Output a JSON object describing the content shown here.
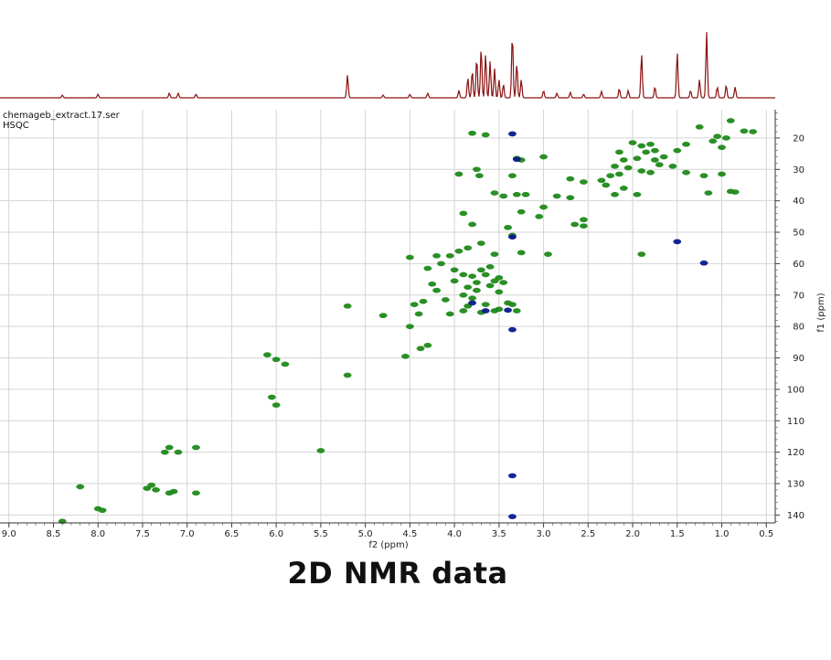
{
  "file_name": "chemageb_extract.17.ser",
  "experiment": "HSQC",
  "caption": "2D NMR data",
  "colors": {
    "positive": "#1f8a1a",
    "negative": "#0a1a8c",
    "trace": "#8b1010",
    "grid": "#d4d4d4"
  },
  "chart_data": {
    "type": "scatter",
    "xlabel": "f2 (ppm)",
    "ylabel": "f1 (ppm)",
    "xlim": [
      9.1,
      0.4
    ],
    "ylim": [
      11,
      142.5
    ],
    "x_ticks": [
      "9.0",
      "8.5",
      "8.0",
      "7.5",
      "7.0",
      "6.5",
      "6.0",
      "5.5",
      "5.0",
      "4.5",
      "4.0",
      "3.5",
      "3.0",
      "2.5",
      "2.0",
      "1.5",
      "1.0",
      "0.5"
    ],
    "y_ticks": [
      "20",
      "30",
      "40",
      "50",
      "60",
      "70",
      "80",
      "90",
      "100",
      "110",
      "120",
      "130",
      "140"
    ],
    "grid": true,
    "series": [
      {
        "sign": "positive",
        "points": [
          [
            3.8,
            18.5
          ],
          [
            3.65,
            19.0
          ],
          [
            1.05,
            19.5
          ],
          [
            0.95,
            20.0
          ],
          [
            0.9,
            14.5
          ],
          [
            0.75,
            17.8
          ],
          [
            0.65,
            18.0
          ],
          [
            1.25,
            16.5
          ],
          [
            1.1,
            21.0
          ],
          [
            1.0,
            23.0
          ],
          [
            2.0,
            21.5
          ],
          [
            1.9,
            22.5
          ],
          [
            1.85,
            24.5
          ],
          [
            1.75,
            24.0
          ],
          [
            1.65,
            26.0
          ],
          [
            1.5,
            24.0
          ],
          [
            1.4,
            22.0
          ],
          [
            1.75,
            27.0
          ],
          [
            1.7,
            28.5
          ],
          [
            1.55,
            29.0
          ],
          [
            1.95,
            26.5
          ],
          [
            2.1,
            27.0
          ],
          [
            2.2,
            29.0
          ],
          [
            2.05,
            29.5
          ],
          [
            1.9,
            30.5
          ],
          [
            1.8,
            31.0
          ],
          [
            2.15,
            31.5
          ],
          [
            2.25,
            32.0
          ],
          [
            2.35,
            33.5
          ],
          [
            2.55,
            34.0
          ],
          [
            2.7,
            33.0
          ],
          [
            2.3,
            35.0
          ],
          [
            2.1,
            36.0
          ],
          [
            1.95,
            38.0
          ],
          [
            2.2,
            38.0
          ],
          [
            1.4,
            31.0
          ],
          [
            1.2,
            32.0
          ],
          [
            1.0,
            31.5
          ],
          [
            0.9,
            37.0
          ],
          [
            0.85,
            37.2
          ],
          [
            1.15,
            37.5
          ],
          [
            2.15,
            24.5
          ],
          [
            1.8,
            22.0
          ],
          [
            3.3,
            26.5
          ],
          [
            3.25,
            27.0
          ],
          [
            3.0,
            26.0
          ],
          [
            3.35,
            32.0
          ],
          [
            3.75,
            30.0
          ],
          [
            3.72,
            32.0
          ],
          [
            3.3,
            38.0
          ],
          [
            3.2,
            38.0
          ],
          [
            2.85,
            38.5
          ],
          [
            2.7,
            39.0
          ],
          [
            3.45,
            38.5
          ],
          [
            3.55,
            37.5
          ],
          [
            3.95,
            31.5
          ],
          [
            3.0,
            42.0
          ],
          [
            3.25,
            43.5
          ],
          [
            3.05,
            45.0
          ],
          [
            2.55,
            46.0
          ],
          [
            2.65,
            47.5
          ],
          [
            2.55,
            48.0
          ],
          [
            3.4,
            48.5
          ],
          [
            3.35,
            51.0
          ],
          [
            3.9,
            44.0
          ],
          [
            3.8,
            47.5
          ],
          [
            3.7,
            53.5
          ],
          [
            3.85,
            55.0
          ],
          [
            3.95,
            56.0
          ],
          [
            4.05,
            57.5
          ],
          [
            4.2,
            57.5
          ],
          [
            3.55,
            57.0
          ],
          [
            3.25,
            56.5
          ],
          [
            2.95,
            57.0
          ],
          [
            1.9,
            57.0
          ],
          [
            4.5,
            58.0
          ],
          [
            4.15,
            60.0
          ],
          [
            4.3,
            61.5
          ],
          [
            4.0,
            62.0
          ],
          [
            3.9,
            63.5
          ],
          [
            3.8,
            64.0
          ],
          [
            3.65,
            63.5
          ],
          [
            3.5,
            64.5
          ],
          [
            3.6,
            61.0
          ],
          [
            3.7,
            62.0
          ],
          [
            3.55,
            65.5
          ],
          [
            3.6,
            67.0
          ],
          [
            3.45,
            66.0
          ],
          [
            4.25,
            66.5
          ],
          [
            4.2,
            68.5
          ],
          [
            3.85,
            67.5
          ],
          [
            3.75,
            68.5
          ],
          [
            3.9,
            70.0
          ],
          [
            3.8,
            71.0
          ],
          [
            4.1,
            71.5
          ],
          [
            4.35,
            72.0
          ],
          [
            4.45,
            73.0
          ],
          [
            3.85,
            73.5
          ],
          [
            3.9,
            75.0
          ],
          [
            3.7,
            75.5
          ],
          [
            3.65,
            73.0
          ],
          [
            3.55,
            75.0
          ],
          [
            3.5,
            74.5
          ],
          [
            3.4,
            72.5
          ],
          [
            3.35,
            73.0
          ],
          [
            3.3,
            75.0
          ],
          [
            4.05,
            76.0
          ],
          [
            4.4,
            76.0
          ],
          [
            4.8,
            76.5
          ],
          [
            5.2,
            73.5
          ],
          [
            4.5,
            80.0
          ],
          [
            4.3,
            86.0
          ],
          [
            4.38,
            87.0
          ],
          [
            4.55,
            89.5
          ],
          [
            5.2,
            95.5
          ],
          [
            6.1,
            89.0
          ],
          [
            6.0,
            90.5
          ],
          [
            5.9,
            92.0
          ],
          [
            6.05,
            102.5
          ],
          [
            6.0,
            105.0
          ],
          [
            5.5,
            119.5
          ],
          [
            6.9,
            118.5
          ],
          [
            7.2,
            118.5
          ],
          [
            7.25,
            120.0
          ],
          [
            7.1,
            120.0
          ],
          [
            7.4,
            130.5
          ],
          [
            7.45,
            131.5
          ],
          [
            7.35,
            132.0
          ],
          [
            7.2,
            133.0
          ],
          [
            7.15,
            132.5
          ],
          [
            6.9,
            133.0
          ],
          [
            8.2,
            131.0
          ],
          [
            8.0,
            138.0
          ],
          [
            7.95,
            138.5
          ],
          [
            8.4,
            142.0
          ],
          [
            3.5,
            69.0
          ],
          [
            4.0,
            65.5
          ],
          [
            3.75,
            66.0
          ]
        ]
      },
      {
        "sign": "negative",
        "points": [
          [
            3.35,
            18.7
          ],
          [
            3.8,
            72.5
          ],
          [
            3.65,
            75.0
          ],
          [
            3.4,
            74.8
          ],
          [
            3.35,
            51.5
          ],
          [
            1.5,
            53.0
          ],
          [
            1.2,
            59.8
          ],
          [
            3.35,
            81.0
          ],
          [
            3.35,
            127.5
          ],
          [
            3.35,
            140.5
          ],
          [
            3.3,
            26.8
          ]
        ]
      }
    ]
  }
}
